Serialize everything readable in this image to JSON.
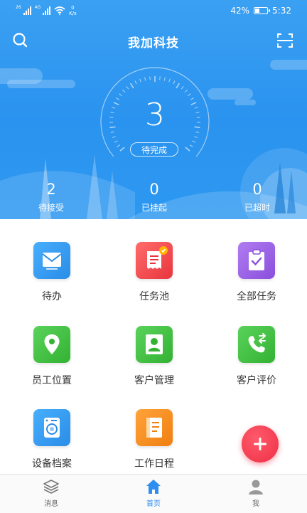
{
  "status_bar": {
    "signal1_tag": "26",
    "signal2_tag": "4G",
    "net_speed_value": "0",
    "net_speed_unit": "K/s",
    "battery_percent": "42%",
    "battery_level": 0.42,
    "time": "5:32"
  },
  "header": {
    "title": "我加科技",
    "icons": {
      "search": "search-icon",
      "scan": "scan-icon"
    }
  },
  "gauge": {
    "value": "3",
    "label": "待完成"
  },
  "stats": [
    {
      "value": "2",
      "label": "待接受"
    },
    {
      "value": "0",
      "label": "已挂起"
    },
    {
      "value": "0",
      "label": "已超时"
    }
  ],
  "menu": [
    {
      "label": "待办",
      "icon": "mail-icon",
      "color": "#2c93ee"
    },
    {
      "label": "任务池",
      "icon": "receipt-icon",
      "color": "#f0454c"
    },
    {
      "label": "全部任务",
      "icon": "clipboard-check-icon",
      "color": "#9b5de5"
    },
    {
      "label": "员工位置",
      "icon": "location-pin-icon",
      "color": "#3fbf3f"
    },
    {
      "label": "客户管理",
      "icon": "person-icon",
      "color": "#3fbf3f"
    },
    {
      "label": "客户评价",
      "icon": "phone-transfer-icon",
      "color": "#3fbf3f"
    },
    {
      "label": "设备档案",
      "icon": "washing-machine-icon",
      "color": "#2c93ee"
    },
    {
      "label": "工作日程",
      "icon": "notebook-icon",
      "color": "#f58a1f"
    }
  ],
  "fab": {
    "icon": "plus-icon",
    "color": "#ee2f45"
  },
  "bottom_nav": [
    {
      "label": "消息",
      "icon": "layers-icon",
      "active": false
    },
    {
      "label": "首页",
      "icon": "home-icon",
      "active": true
    },
    {
      "label": "我",
      "icon": "user-icon",
      "active": false
    }
  ],
  "colors": {
    "primary": "#2d93ef",
    "accent_active": "#2d8ff0"
  }
}
